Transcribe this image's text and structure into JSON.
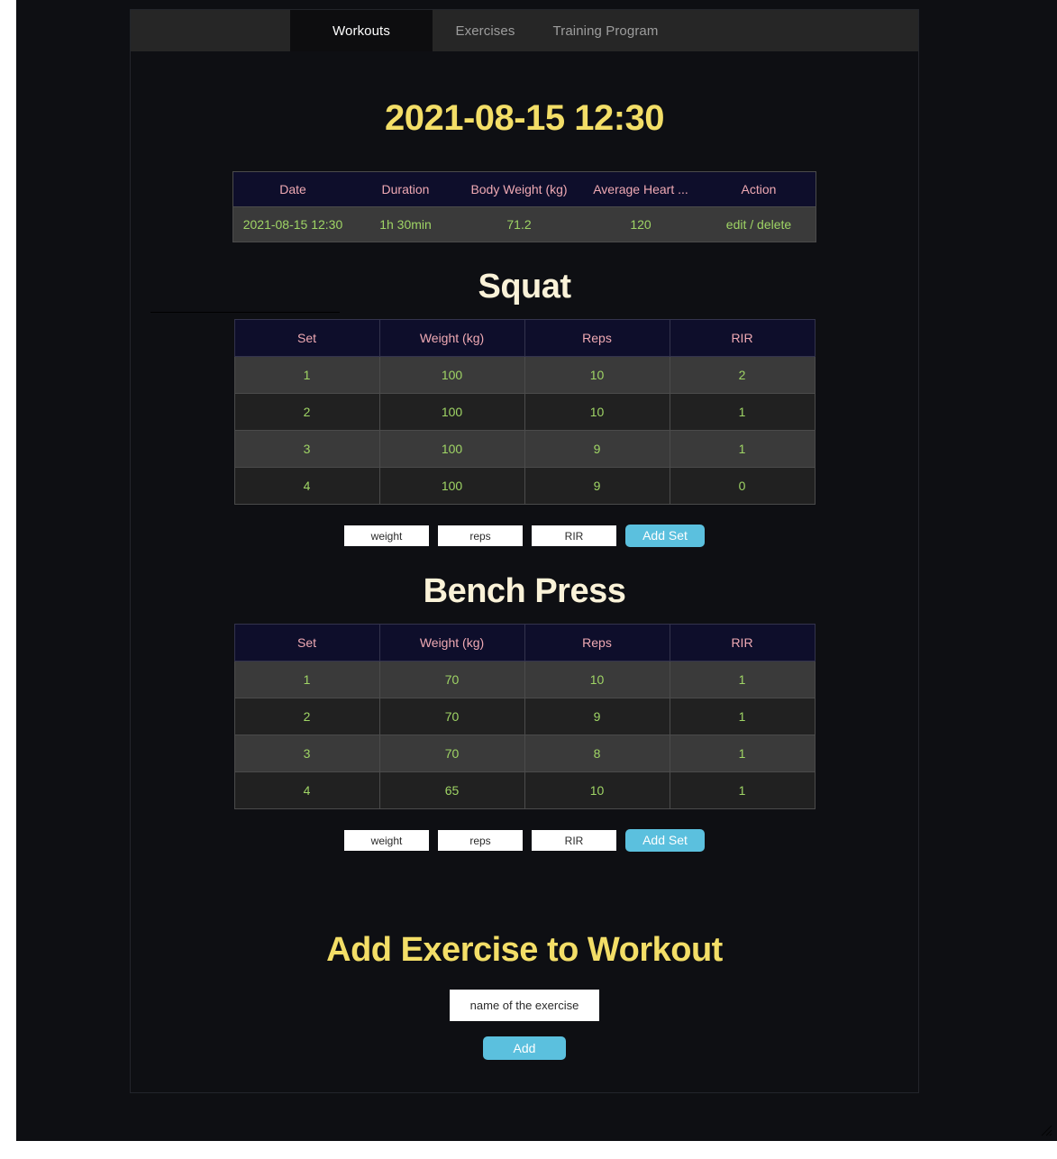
{
  "nav": {
    "tabs": [
      {
        "label": "Workouts",
        "active": true
      },
      {
        "label": "Exercises",
        "active": false
      },
      {
        "label": "Training Program",
        "active": false
      }
    ]
  },
  "page": {
    "title": "2021-08-15 12:30"
  },
  "summary": {
    "columns": [
      "Date",
      "Duration",
      "Body Weight (kg)",
      "Average Heart ...",
      "Action"
    ],
    "rows": [
      {
        "date": "2021-08-15 12:30",
        "duration": "1h 30min",
        "body_weight": "71.2",
        "average_heart_rate": "120",
        "action": "edit / delete"
      }
    ]
  },
  "exercises": [
    {
      "name": "Squat",
      "columns": [
        "Set",
        "Weight (kg)",
        "Reps",
        "RIR"
      ],
      "sets": [
        {
          "set": "1",
          "weight": "100",
          "reps": "10",
          "rir": "2"
        },
        {
          "set": "2",
          "weight": "100",
          "reps": "10",
          "rir": "1"
        },
        {
          "set": "3",
          "weight": "100",
          "reps": "9",
          "rir": "1"
        },
        {
          "set": "4",
          "weight": "100",
          "reps": "9",
          "rir": "0"
        }
      ],
      "form": {
        "weight_placeholder": "weight",
        "weight_value": "",
        "reps_placeholder": "reps",
        "reps_value": "",
        "rir_placeholder": "RIR",
        "rir_value": "",
        "submit_label": "Add Set"
      }
    },
    {
      "name": "Bench Press",
      "columns": [
        "Set",
        "Weight (kg)",
        "Reps",
        "RIR"
      ],
      "sets": [
        {
          "set": "1",
          "weight": "70",
          "reps": "10",
          "rir": "1"
        },
        {
          "set": "2",
          "weight": "70",
          "reps": "9",
          "rir": "1"
        },
        {
          "set": "3",
          "weight": "70",
          "reps": "8",
          "rir": "1"
        },
        {
          "set": "4",
          "weight": "65",
          "reps": "10",
          "rir": "1"
        }
      ],
      "form": {
        "weight_placeholder": "weight",
        "weight_value": "",
        "reps_placeholder": "reps",
        "reps_value": "",
        "rir_placeholder": "RIR",
        "rir_value": "",
        "submit_label": "Add Set"
      }
    }
  ],
  "add_exercise": {
    "title": "Add Exercise to Workout",
    "name_placeholder": "name of the exercise",
    "name_value": "",
    "submit_label": "Add"
  },
  "colors": {
    "page_background": "#0e0f13",
    "navbar_background": "#262626",
    "active_tab_background": "#0d0d0f",
    "title_yellow": "#f3de67",
    "exercise_heading_cream": "#faf2d8",
    "table_header_navy": "#0e0e2b",
    "table_header_pink": "#efa9b3",
    "table_value_green": "#9fd465",
    "row_odd": "#3a3a3a",
    "row_even": "#212121",
    "button_blue": "#5bc0de"
  }
}
